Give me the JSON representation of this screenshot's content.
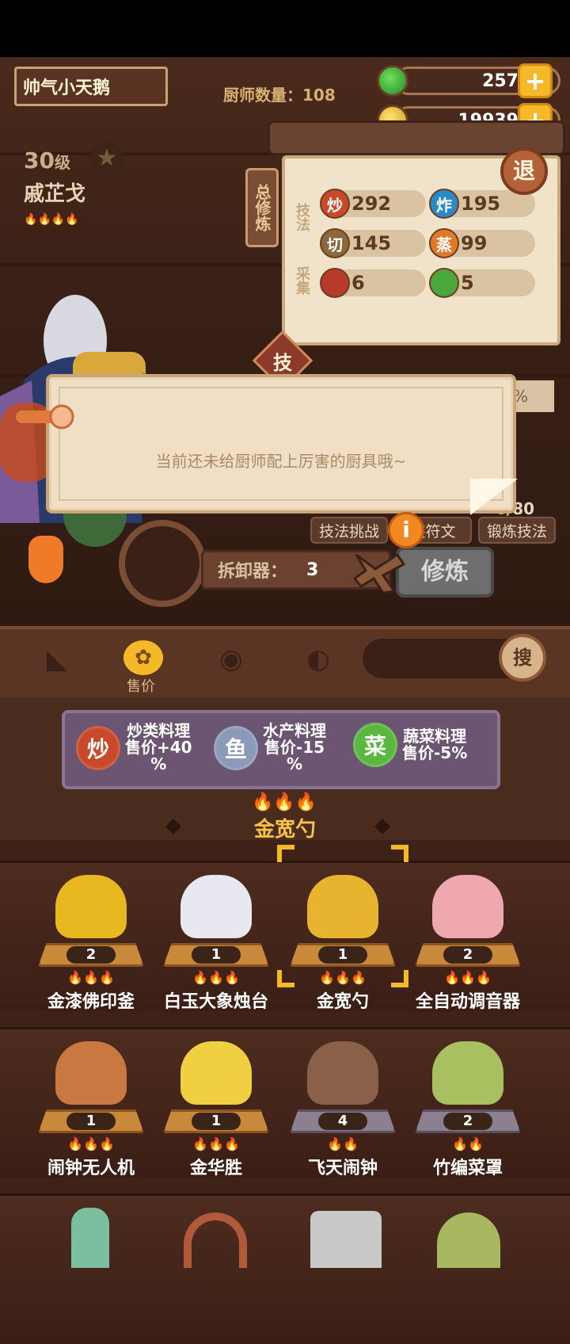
{
  "player": {
    "name": "帅气小天鹅",
    "chef_count_label": "厨师数量：108"
  },
  "resources": {
    "jade": "257",
    "coins": "19939",
    "plus": "+"
  },
  "chef": {
    "level_num": "30",
    "level_unit": "级",
    "name": "戚芷戈",
    "stars": 4
  },
  "panel": {
    "side_tag": "总修炼",
    "technique_label": "技法",
    "gather_label": "采集",
    "back": "退",
    "ji": "技",
    "pct": "%",
    "skills": [
      {
        "icon": "炒",
        "value": "292",
        "color": "#c84a2a"
      },
      {
        "icon": "炸",
        "value": "195",
        "color": "#2a8ac8"
      },
      {
        "icon": "切",
        "value": "145",
        "color": "#8a6a3a"
      },
      {
        "icon": "蒸",
        "value": "99",
        "color": "#e07a2a"
      },
      {
        "icon": "",
        "value": "6",
        "color": "#b83a2a"
      },
      {
        "icon": "",
        "value": "5",
        "color": "#4aa83a"
      }
    ]
  },
  "dialog": {
    "text": "当前还未给厨师配上厉害的厨具哦~"
  },
  "actions": {
    "challenge": "技法挑战",
    "rune": "装符文",
    "forge": "锻炼技法",
    "counter_cur": "0",
    "counter_total": "/80"
  },
  "dismantle": {
    "label": "拆卸器：",
    "count": "3",
    "refine": "修炼",
    "info": "i"
  },
  "filters": {
    "price_label": "售价",
    "search": "搜"
  },
  "bonuses": [
    {
      "icon": "炒",
      "line1": "炒类料理",
      "line2": "售价+40",
      "line3": "%",
      "color": "#c84a2a"
    },
    {
      "icon": "鱼",
      "line1": "水产料理",
      "line2": "售价-15",
      "line3": "%",
      "color": "#8a9ab8"
    },
    {
      "icon": "菜",
      "line1": "蔬菜料理",
      "line2": "售价-5%",
      "line3": "",
      "color": "#5ab840"
    }
  ],
  "selected": {
    "name": "金宽勺",
    "stars": 3
  },
  "items": [
    {
      "name": "金漆佛印釜",
      "count": "2",
      "stars": 3,
      "color": "#e8b820",
      "tier": "gold"
    },
    {
      "name": "白玉大象烛台",
      "count": "1",
      "stars": 3,
      "color": "#e8e8f0",
      "tier": "gold"
    },
    {
      "name": "金宽勺",
      "count": "1",
      "stars": 3,
      "color": "#e8b430",
      "tier": "gold"
    },
    {
      "name": "全自动调音器",
      "count": "2",
      "stars": 3,
      "color": "#f0a8b0",
      "tier": "gold"
    },
    {
      "name": "闹钟无人机",
      "count": "1",
      "stars": 3,
      "color": "#c87840",
      "tier": "gold"
    },
    {
      "name": "金华胜",
      "count": "1",
      "stars": 3,
      "color": "#f0d040",
      "tier": "gold"
    },
    {
      "name": "飞天闹钟",
      "count": "4",
      "stars": 2,
      "color": "#8a6048",
      "tier": "gray"
    },
    {
      "name": "竹编菜罩",
      "count": "2",
      "stars": 2,
      "color": "#a8c060",
      "tier": "gray"
    }
  ]
}
